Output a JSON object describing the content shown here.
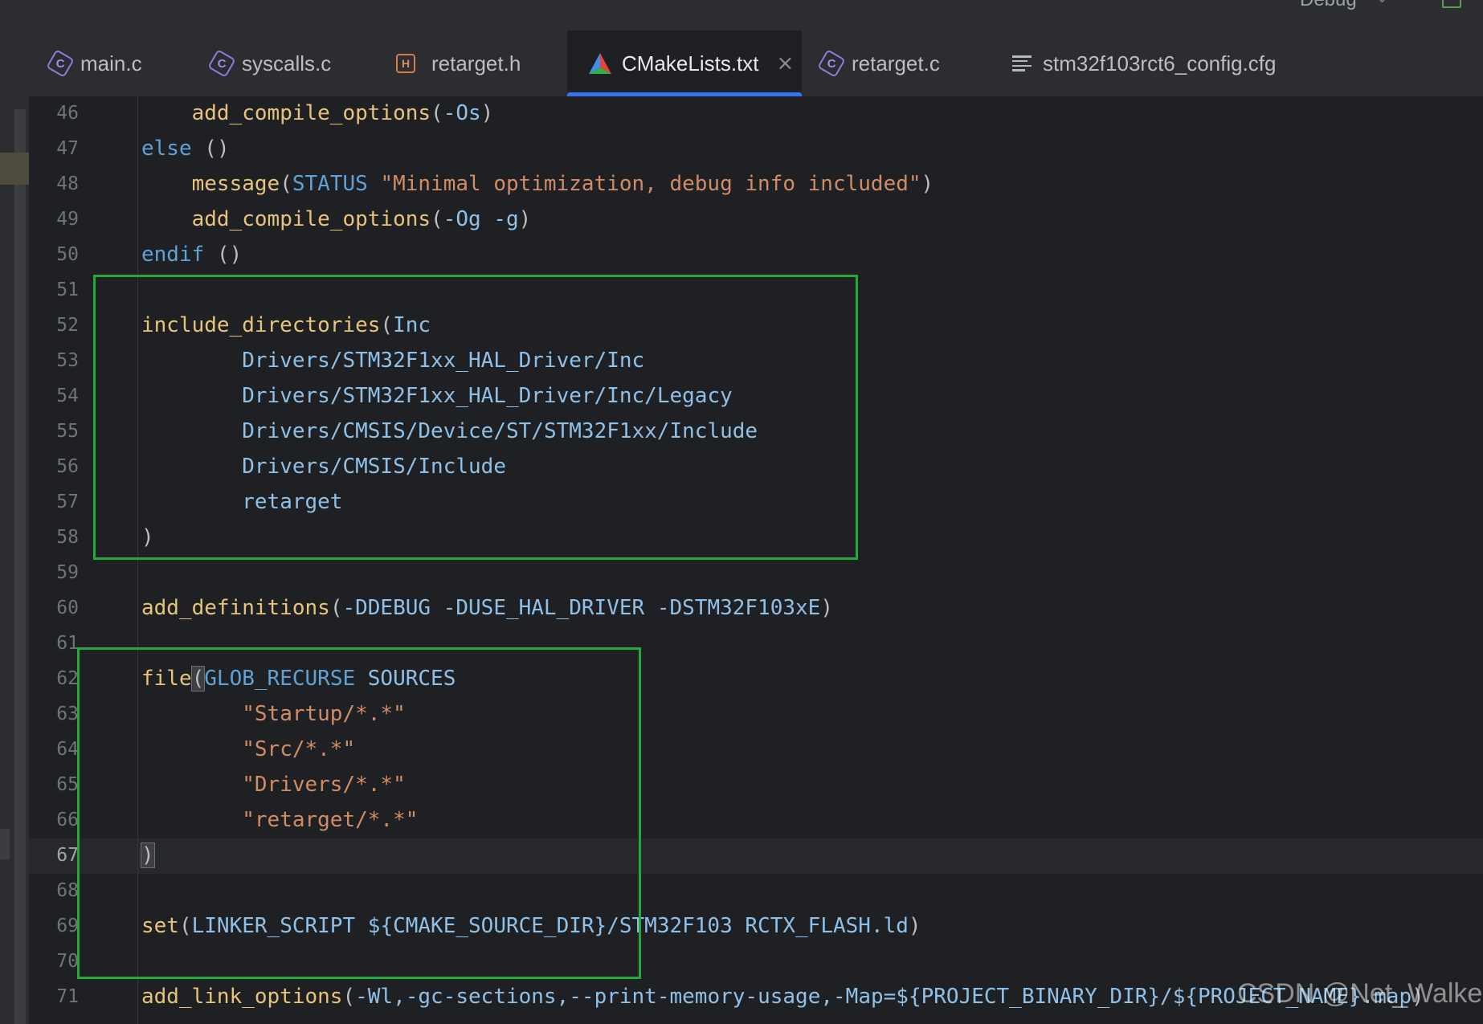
{
  "topbar": {
    "config_label": "Debug"
  },
  "tabs": [
    {
      "label": "main.c",
      "icon": "c-file-icon",
      "active": false
    },
    {
      "label": "syscalls.c",
      "icon": "c-file-icon",
      "active": false
    },
    {
      "label": "retarget.h",
      "icon": "header-file-icon",
      "active": false
    },
    {
      "label": "CMakeLists.txt",
      "icon": "cmake-icon",
      "active": true,
      "closable": true
    },
    {
      "label": "retarget.c",
      "icon": "c-file-icon",
      "active": false
    },
    {
      "label": "stm32f103rct6_config.cfg",
      "icon": "text-file-icon",
      "active": false
    }
  ],
  "editor": {
    "current_line": 67,
    "lines": [
      {
        "num": "46",
        "text": "    add_compile_options(-Os)"
      },
      {
        "num": "47",
        "text": "else ()"
      },
      {
        "num": "48",
        "text": "    message(STATUS \"Minimal optimization, debug info included\")"
      },
      {
        "num": "49",
        "text": "    add_compile_options(-Og -g)"
      },
      {
        "num": "50",
        "text": "endif ()"
      },
      {
        "num": "51",
        "text": ""
      },
      {
        "num": "52",
        "text": "include_directories(Inc"
      },
      {
        "num": "53",
        "text": "        Drivers/STM32F1xx_HAL_Driver/Inc"
      },
      {
        "num": "54",
        "text": "        Drivers/STM32F1xx_HAL_Driver/Inc/Legacy"
      },
      {
        "num": "55",
        "text": "        Drivers/CMSIS/Device/ST/STM32F1xx/Include"
      },
      {
        "num": "56",
        "text": "        Drivers/CMSIS/Include"
      },
      {
        "num": "57",
        "text": "        retarget"
      },
      {
        "num": "58",
        "text": ")"
      },
      {
        "num": "59",
        "text": ""
      },
      {
        "num": "60",
        "text": "add_definitions(-DDEBUG -DUSE_HAL_DRIVER -DSTM32F103xE)"
      },
      {
        "num": "61",
        "text": ""
      },
      {
        "num": "62",
        "text": "file(GLOB_RECURSE SOURCES"
      },
      {
        "num": "63",
        "text": "        \"Startup/*.*\""
      },
      {
        "num": "64",
        "text": "        \"Src/*.*\""
      },
      {
        "num": "65",
        "text": "        \"Drivers/*.*\""
      },
      {
        "num": "66",
        "text": "        \"retarget/*.*\""
      },
      {
        "num": "67",
        "text": ")"
      },
      {
        "num": "68",
        "text": ""
      },
      {
        "num": "69",
        "text": "set(LINKER_SCRIPT ${CMAKE_SOURCE_DIR}/STM32F103RCTX_FLASH.ld)"
      },
      {
        "num": "70",
        "text": ""
      },
      {
        "num": "71",
        "text": "add_link_options(-Wl,-gc-sections,--print-memory-usage,-Map=${PROJECT_BINARY_DIR}/${PROJECT_NAME}.map)"
      }
    ]
  },
  "annotations": {
    "box_color": "#24a93b"
  },
  "watermark": "CSDN @Net_Walke",
  "colors": {
    "background": "#1f2023",
    "tabbar": "#2b2d30",
    "active_tab_underline": "#3574f0",
    "function": "#e8c37a",
    "keyword": "#5ea2d6",
    "string": "#d28c64",
    "argument": "#8fc0e8"
  }
}
